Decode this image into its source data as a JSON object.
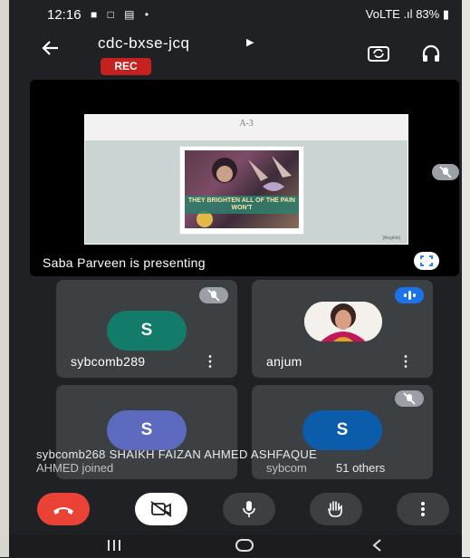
{
  "status_bar": {
    "time": "12:16",
    "left_icons": "■ □ ▤ •",
    "network": "VoLTE .ıl",
    "battery": "83%"
  },
  "header": {
    "meeting_code": "cdc-bxse-jcq",
    "rec_label": "REC"
  },
  "presentation": {
    "slide_heading": "A-3",
    "art_caption": "THEY BRIGHTEN ALL OF THE PAIN WON'T",
    "slide_footer": "[illegible]",
    "presenting_text": "Saba Parveen is presenting"
  },
  "tiles": [
    {
      "name": "sybcomb289",
      "initial": "S",
      "avatar_color": "#137b6a",
      "muted": true
    },
    {
      "name": "anjum",
      "initial": "",
      "avatar_color": "#f2eeea",
      "muted": false,
      "talking": true
    },
    {
      "name": "",
      "initial": "S",
      "avatar_color": "#5c6bc0",
      "muted": false
    },
    {
      "name": "",
      "initial": "S",
      "avatar_color": "#0b5cab",
      "muted": true
    }
  ],
  "toast": {
    "line1": "sybcomb268 SHAIKH FAIZAN AHMED ASHFAQUE",
    "line2": "AHMED joined",
    "overlay_left": "",
    "overlay_name": "sybcom",
    "others_label": "51 others"
  },
  "colors": {
    "background": "#202124",
    "tile": "#3c4043",
    "end_call": "#ea4335",
    "rec": "#c5221f",
    "accent_blue": "#1a73e8"
  },
  "icons": {
    "back": "arrow-left",
    "switch_camera": "camera-flip",
    "audio": "headphones",
    "mic_off": "mic-off",
    "fullscreen": "fullscreen",
    "more": "more-vertical",
    "end_call": "phone-hangup",
    "camera_off": "video-off",
    "mic": "mic",
    "raise_hand": "hand"
  }
}
